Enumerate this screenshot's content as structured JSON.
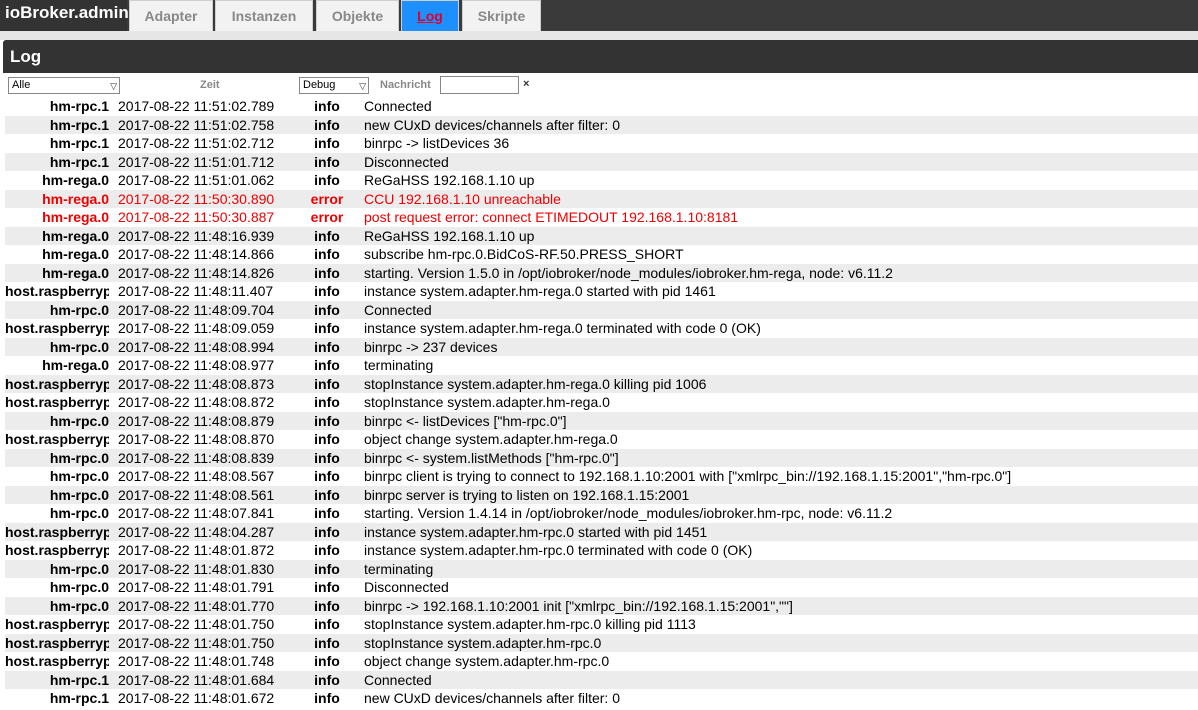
{
  "app": {
    "title": "ioBroker.admin"
  },
  "tabs": [
    "Adapter",
    "Instanzen",
    "Objekte",
    "Log",
    "Skripte"
  ],
  "active_tab": "Log",
  "panel": {
    "title": "Log"
  },
  "filters": {
    "source_value": "Alle",
    "time_label": "Zeit",
    "level_value": "Debug",
    "message_label": "Nachricht",
    "message_value": "",
    "clear_icon": "×"
  },
  "log": [
    {
      "source": "hm-rpc.1",
      "time": "2017-08-22 11:51:02.789",
      "level": "info",
      "message": "Connected"
    },
    {
      "source": "hm-rpc.1",
      "time": "2017-08-22 11:51:02.758",
      "level": "info",
      "message": "new CUxD devices/channels after filter: 0"
    },
    {
      "source": "hm-rpc.1",
      "time": "2017-08-22 11:51:02.712",
      "level": "info",
      "message": "binrpc -> listDevices 36"
    },
    {
      "source": "hm-rpc.1",
      "time": "2017-08-22 11:51:01.712",
      "level": "info",
      "message": "Disconnected"
    },
    {
      "source": "hm-rega.0",
      "time": "2017-08-22 11:51:01.062",
      "level": "info",
      "message": "ReGaHSS 192.168.1.10 up"
    },
    {
      "source": "hm-rega.0",
      "time": "2017-08-22 11:50:30.890",
      "level": "error",
      "message": "CCU 192.168.1.10 unreachable"
    },
    {
      "source": "hm-rega.0",
      "time": "2017-08-22 11:50:30.887",
      "level": "error",
      "message": "post request error: connect ETIMEDOUT 192.168.1.10:8181"
    },
    {
      "source": "hm-rega.0",
      "time": "2017-08-22 11:48:16.939",
      "level": "info",
      "message": "ReGaHSS 192.168.1.10 up"
    },
    {
      "source": "hm-rega.0",
      "time": "2017-08-22 11:48:14.866",
      "level": "info",
      "message": "subscribe hm-rpc.0.BidCoS-RF.50.PRESS_SHORT"
    },
    {
      "source": "hm-rega.0",
      "time": "2017-08-22 11:48:14.826",
      "level": "info",
      "message": "starting. Version 1.5.0 in /opt/iobroker/node_modules/iobroker.hm-rega, node: v6.11.2"
    },
    {
      "source": "host.raspberryp",
      "time": "2017-08-22 11:48:11.407",
      "level": "info",
      "message": "instance system.adapter.hm-rega.0 started with pid 1461"
    },
    {
      "source": "hm-rpc.0",
      "time": "2017-08-22 11:48:09.704",
      "level": "info",
      "message": "Connected"
    },
    {
      "source": "host.raspberryp",
      "time": "2017-08-22 11:48:09.059",
      "level": "info",
      "message": "instance system.adapter.hm-rega.0 terminated with code 0 (OK)"
    },
    {
      "source": "hm-rpc.0",
      "time": "2017-08-22 11:48:08.994",
      "level": "info",
      "message": "binrpc -> 237 devices"
    },
    {
      "source": "hm-rega.0",
      "time": "2017-08-22 11:48:08.977",
      "level": "info",
      "message": "terminating"
    },
    {
      "source": "host.raspberryp",
      "time": "2017-08-22 11:48:08.873",
      "level": "info",
      "message": "stopInstance system.adapter.hm-rega.0 killing pid 1006"
    },
    {
      "source": "host.raspberryp",
      "time": "2017-08-22 11:48:08.872",
      "level": "info",
      "message": "stopInstance system.adapter.hm-rega.0"
    },
    {
      "source": "hm-rpc.0",
      "time": "2017-08-22 11:48:08.879",
      "level": "info",
      "message": "binrpc <- listDevices [\"hm-rpc.0\"]"
    },
    {
      "source": "host.raspberryp",
      "time": "2017-08-22 11:48:08.870",
      "level": "info",
      "message": "object change system.adapter.hm-rega.0"
    },
    {
      "source": "hm-rpc.0",
      "time": "2017-08-22 11:48:08.839",
      "level": "info",
      "message": "binrpc <- system.listMethods [\"hm-rpc.0\"]"
    },
    {
      "source": "hm-rpc.0",
      "time": "2017-08-22 11:48:08.567",
      "level": "info",
      "message": "binrpc client is trying to connect to 192.168.1.10:2001 with [\"xmlrpc_bin://192.168.1.15:2001\",\"hm-rpc.0\"]"
    },
    {
      "source": "hm-rpc.0",
      "time": "2017-08-22 11:48:08.561",
      "level": "info",
      "message": "binrpc server is trying to listen on 192.168.1.15:2001"
    },
    {
      "source": "hm-rpc.0",
      "time": "2017-08-22 11:48:07.841",
      "level": "info",
      "message": "starting. Version 1.4.14 in /opt/iobroker/node_modules/iobroker.hm-rpc, node: v6.11.2"
    },
    {
      "source": "host.raspberryp",
      "time": "2017-08-22 11:48:04.287",
      "level": "info",
      "message": "instance system.adapter.hm-rpc.0 started with pid 1451"
    },
    {
      "source": "host.raspberryp",
      "time": "2017-08-22 11:48:01.872",
      "level": "info",
      "message": "instance system.adapter.hm-rpc.0 terminated with code 0 (OK)"
    },
    {
      "source": "hm-rpc.0",
      "time": "2017-08-22 11:48:01.830",
      "level": "info",
      "message": "terminating"
    },
    {
      "source": "hm-rpc.0",
      "time": "2017-08-22 11:48:01.791",
      "level": "info",
      "message": "Disconnected"
    },
    {
      "source": "hm-rpc.0",
      "time": "2017-08-22 11:48:01.770",
      "level": "info",
      "message": "binrpc -> 192.168.1.10:2001 init [\"xmlrpc_bin://192.168.1.15:2001\",\"\"]"
    },
    {
      "source": "host.raspberryp",
      "time": "2017-08-22 11:48:01.750",
      "level": "info",
      "message": "stopInstance system.adapter.hm-rpc.0 killing pid 1113"
    },
    {
      "source": "host.raspberryp",
      "time": "2017-08-22 11:48:01.750",
      "level": "info",
      "message": "stopInstance system.adapter.hm-rpc.0"
    },
    {
      "source": "host.raspberryp",
      "time": "2017-08-22 11:48:01.748",
      "level": "info",
      "message": "object change system.adapter.hm-rpc.0"
    },
    {
      "source": "hm-rpc.1",
      "time": "2017-08-22 11:48:01.684",
      "level": "info",
      "message": "Connected"
    },
    {
      "source": "hm-rpc.1",
      "time": "2017-08-22 11:48:01.672",
      "level": "info",
      "message": "new CUxD devices/channels after filter: 0"
    }
  ]
}
